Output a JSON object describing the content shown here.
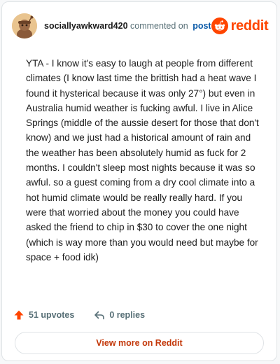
{
  "header": {
    "username": "sociallyawkward420",
    "commented_on": "commented on",
    "post_link": "post",
    "brand_word": "reddit",
    "brand_color": "#ff4500"
  },
  "comment": {
    "text": "YTA - I know it's easy to laugh at people from different climates (I know last time the brittish had a heat wave I found it hysterical because it was only 27°) but even in Australia humid weather is fucking awful. I live in Alice Springs (middle of the aussie desert for those that don't know) and we just had a historical amount of rain and the weather has been absolutely humid as fuck for 2 months. I couldn't sleep most nights because it was so awful. so a guest coming from a dry cool climate into a hot humid climate would be really really hard. If you were that worried about the money you could have asked the friend to chip in $30 to cover the one night (which is way more than you would need but maybe for space + food idk)"
  },
  "footer": {
    "upvotes": "51 upvotes",
    "replies": "0 replies",
    "upvote_icon": "arrow-up-icon",
    "reply_icon": "reply-arrow-icon",
    "upvote_color": "#ff4500"
  },
  "cta": {
    "label": "View more on Reddit",
    "color": "#c3380a"
  }
}
